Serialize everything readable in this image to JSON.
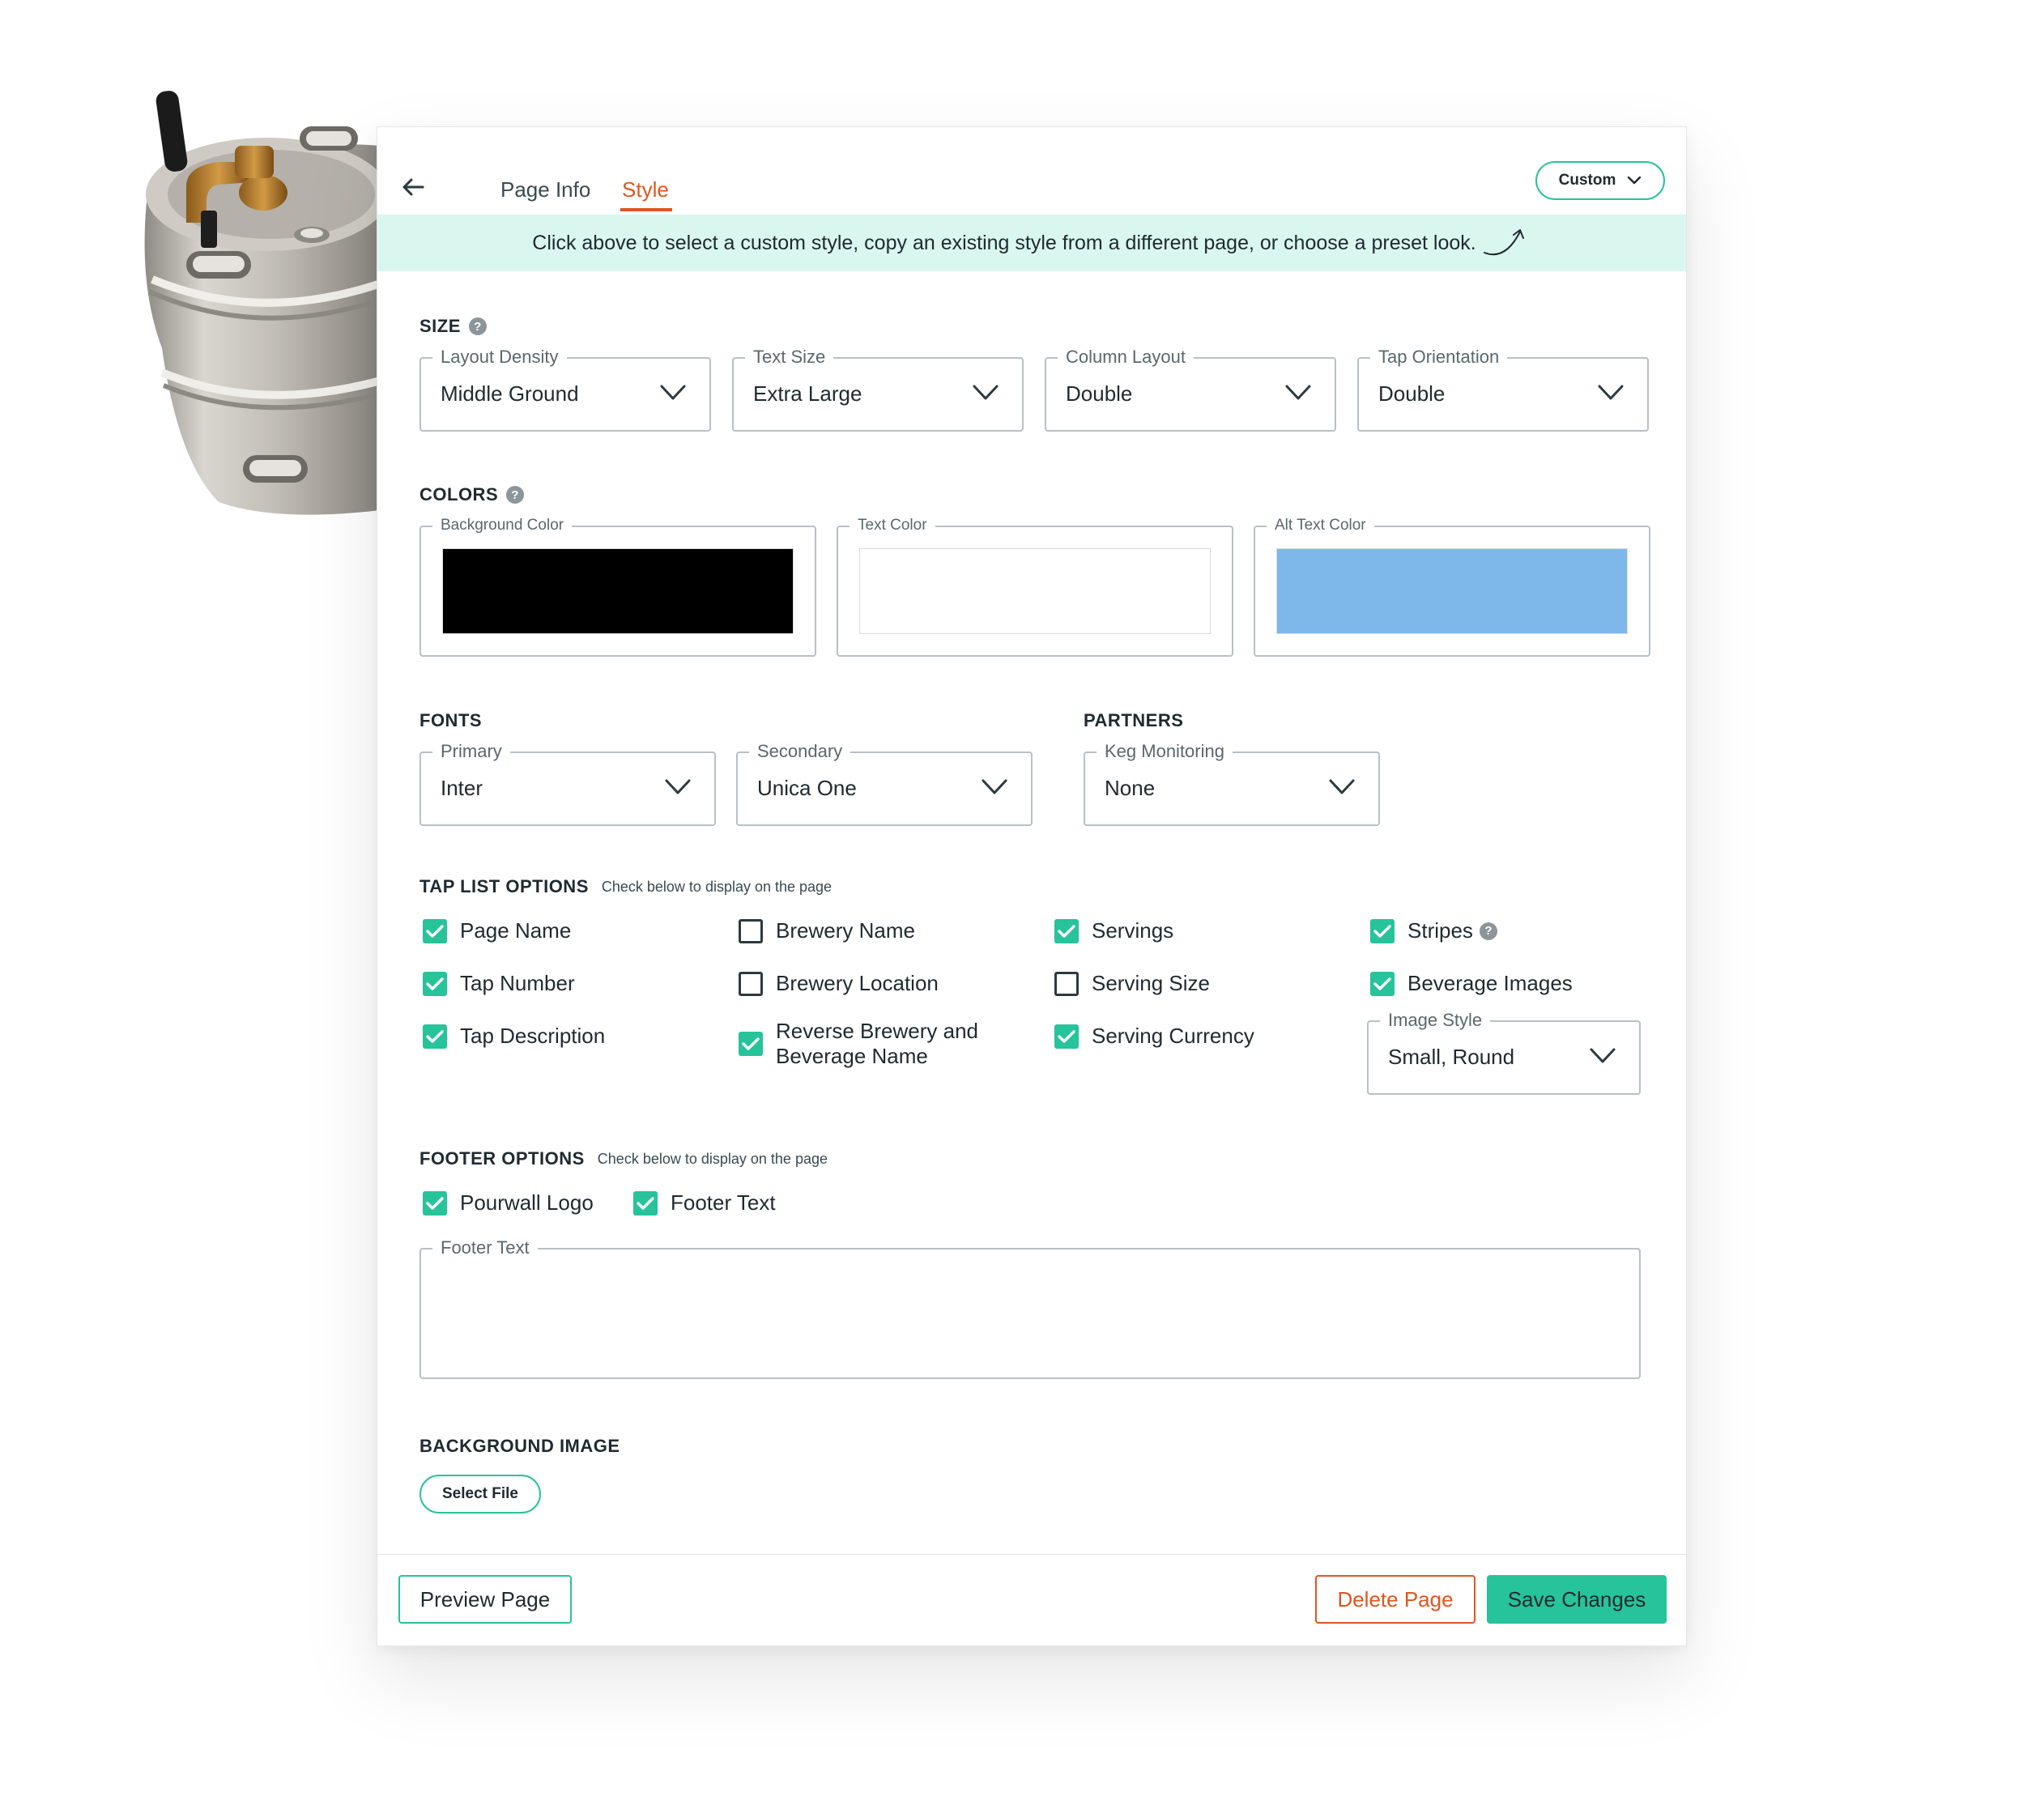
{
  "tabs": [
    {
      "label": "Page Info"
    },
    {
      "label": "Style"
    }
  ],
  "preset_select": {
    "value": "Custom"
  },
  "banner_text": "Click above to select a custom style, copy an existing style from a different page, or choose a preset look.",
  "size": {
    "title": "SIZE",
    "fields": [
      {
        "label": "Layout Density",
        "value": "Middle Ground"
      },
      {
        "label": "Text Size",
        "value": "Extra Large"
      },
      {
        "label": "Column Layout",
        "value": "Double"
      },
      {
        "label": "Tap Orientation",
        "value": "Double"
      }
    ]
  },
  "colors": {
    "title": "COLORS",
    "fields": [
      {
        "label": "Background Color",
        "color": "#000000"
      },
      {
        "label": "Text Color",
        "color": "#ffffff"
      },
      {
        "label": "Alt Text Color",
        "color": "#7eb8ea"
      }
    ]
  },
  "fonts": {
    "title": "FONTS",
    "primary": {
      "label": "Primary",
      "value": "Inter"
    },
    "secondary": {
      "label": "Secondary",
      "value": "Unica One"
    }
  },
  "partners": {
    "title": "PARTNERS",
    "keg_monitoring": {
      "label": "Keg Monitoring",
      "value": "None"
    }
  },
  "tap_list": {
    "title": "TAP LIST OPTIONS",
    "subtitle": "Check below to display on the page",
    "options": [
      {
        "label": "Page Name",
        "checked": true
      },
      {
        "label": "Tap Number",
        "checked": true
      },
      {
        "label": "Tap Description",
        "checked": true
      },
      {
        "label": "Brewery Name",
        "checked": false
      },
      {
        "label": "Brewery Location",
        "checked": false
      },
      {
        "label": "Reverse Brewery and",
        "label2": "Beverage Name",
        "checked": true
      },
      {
        "label": "Servings",
        "checked": true
      },
      {
        "label": "Serving Size",
        "checked": false
      },
      {
        "label": "Serving Currency",
        "checked": true
      },
      {
        "label": "Stripes",
        "checked": true
      },
      {
        "label": "Beverage Images",
        "checked": true
      }
    ],
    "image_style": {
      "label": "Image Style",
      "value": "Small, Round"
    }
  },
  "footer": {
    "title": "FOOTER OPTIONS",
    "subtitle": "Check below to display on the page",
    "options": [
      {
        "label": "Pourwall Logo",
        "checked": true
      },
      {
        "label": "Footer Text",
        "checked": true
      }
    ],
    "text_field": {
      "label": "Footer Text",
      "value": ""
    }
  },
  "background_image": {
    "title": "BACKGROUND IMAGE",
    "button": "Select File"
  },
  "actions": {
    "preview": "Preview Page",
    "delete": "Delete Page",
    "save": "Save Changes"
  },
  "colors_theme": {
    "accent": "#27c39a",
    "danger": "#e0551f",
    "banner_bg": "#d9f7ee"
  }
}
